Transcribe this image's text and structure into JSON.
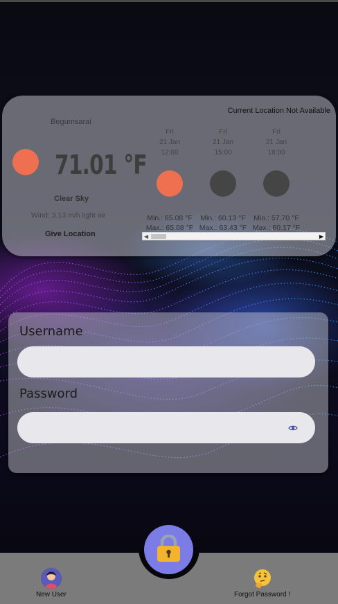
{
  "weather": {
    "city": "Begumsarai",
    "current_location_status": "Current Location Not Available",
    "temperature": "71.01 °F",
    "description": "Clear Sky",
    "wind": "Wind: 3.13 m/h light air",
    "give_location_label": "Give Location",
    "icon": "sun-icon",
    "forecast": [
      {
        "day": "Fri",
        "date": "21 Jan",
        "time": "12:00",
        "min": "Min.: 65.08 °F",
        "max": "Max.: 65.08 °F",
        "icon": "sun-icon",
        "color": "#ee7050"
      },
      {
        "day": "Fri",
        "date": "21 Jan",
        "time": "15:00",
        "min": "Min.: 60.13 °F",
        "max": "Max.: 63.43 °F",
        "icon": "moon-icon",
        "color": "#454545"
      },
      {
        "day": "Fri",
        "date": "21 Jan",
        "time": "18:00",
        "min": "Min.: 57.70 °F",
        "max": "Max.: 60.17 °F",
        "icon": "moon-icon",
        "color": "#454545"
      }
    ]
  },
  "login": {
    "username_label": "Username",
    "username_value": "",
    "password_label": "Password",
    "password_value": "",
    "password_toggle_icon": "eye-icon"
  },
  "nav": {
    "new_user_label": "New User",
    "forgot_password_label": "Forgot Password !",
    "center_icon": "lock-icon"
  },
  "colors": {
    "accent": "#7b7ce6",
    "sun": "#ee7050",
    "nav_bg": "#7b7b7b"
  }
}
